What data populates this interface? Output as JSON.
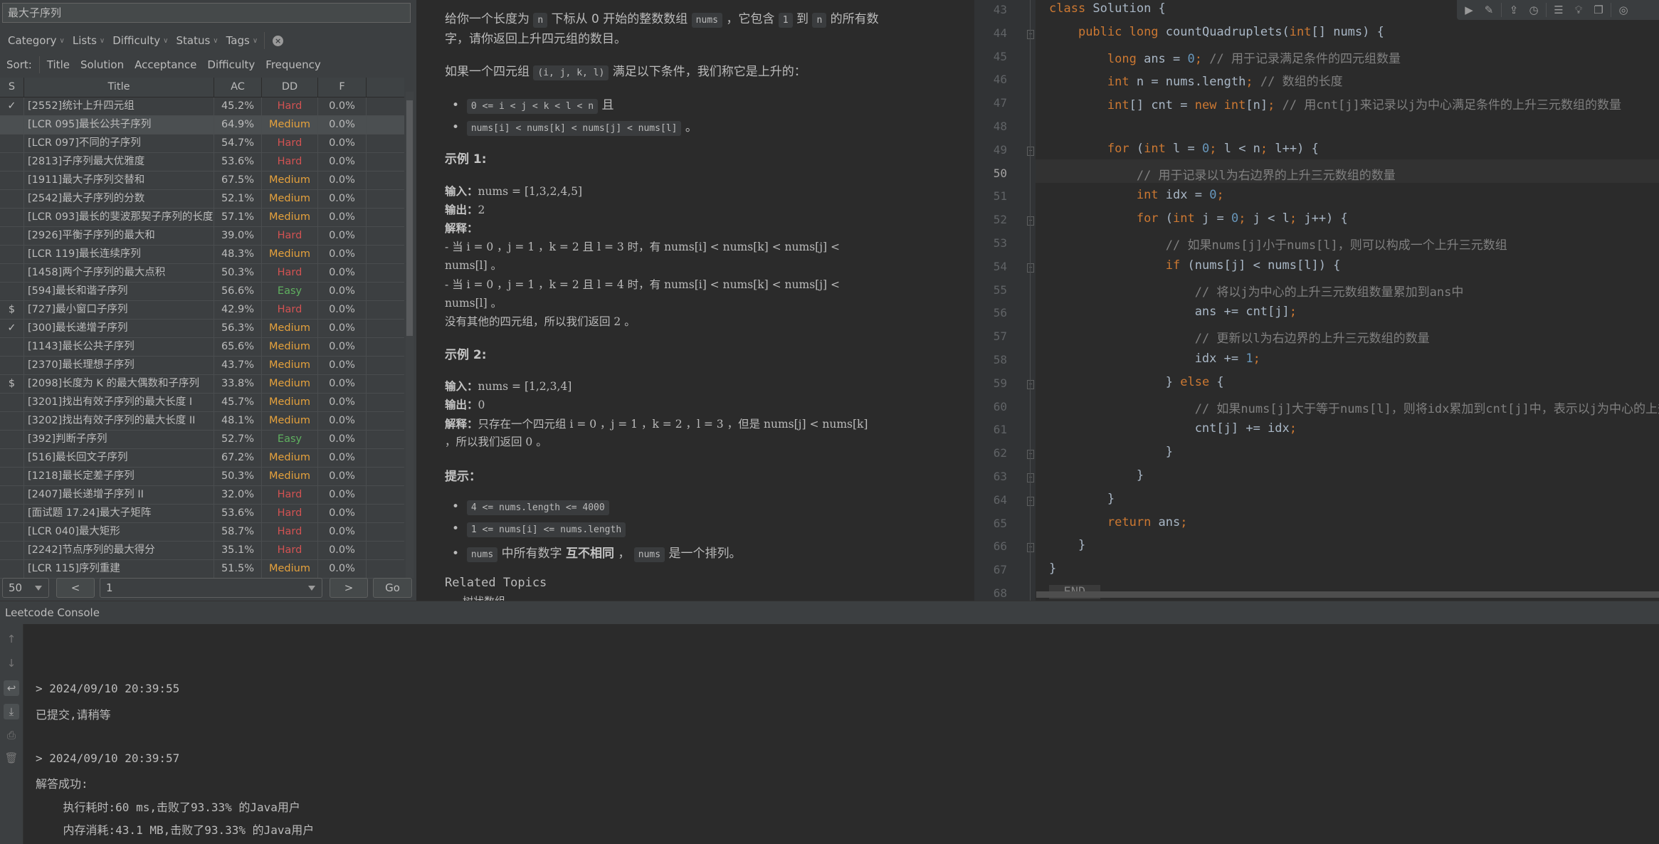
{
  "problem_list": {
    "search_value": "最大子序列",
    "filters": [
      "Category",
      "Lists",
      "Difficulty",
      "Status",
      "Tags"
    ],
    "sort_label": "Sort:",
    "sort_options": [
      "Title",
      "Solution",
      "Acceptance",
      "Difficulty",
      "Frequency"
    ],
    "columns": [
      "S",
      "Title",
      "AC",
      "DD",
      "F"
    ],
    "rows": [
      {
        "status": "✓",
        "title": "[2552]统计上升四元组",
        "ac": "45.2%",
        "difficulty": "Hard",
        "freq": "0.0%"
      },
      {
        "status": "",
        "title": "[LCR 095]最长公共子序列",
        "ac": "64.9%",
        "difficulty": "Medium",
        "freq": "0.0%"
      },
      {
        "status": "",
        "title": "[LCR 097]不同的子序列",
        "ac": "54.7%",
        "difficulty": "Hard",
        "freq": "0.0%"
      },
      {
        "status": "",
        "title": "[2813]子序列最大优雅度",
        "ac": "53.6%",
        "difficulty": "Hard",
        "freq": "0.0%"
      },
      {
        "status": "",
        "title": "[1911]最大子序列交替和",
        "ac": "67.5%",
        "difficulty": "Medium",
        "freq": "0.0%"
      },
      {
        "status": "",
        "title": "[2542]最大子序列的分数",
        "ac": "52.1%",
        "difficulty": "Medium",
        "freq": "0.0%"
      },
      {
        "status": "",
        "title": "[LCR 093]最长的斐波那契子序列的长度",
        "ac": "57.1%",
        "difficulty": "Medium",
        "freq": "0.0%"
      },
      {
        "status": "",
        "title": "[2926]平衡子序列的最大和",
        "ac": "39.0%",
        "difficulty": "Hard",
        "freq": "0.0%"
      },
      {
        "status": "",
        "title": "[LCR 119]最长连续序列",
        "ac": "48.3%",
        "difficulty": "Medium",
        "freq": "0.0%"
      },
      {
        "status": "",
        "title": "[1458]两个子序列的最大点积",
        "ac": "50.3%",
        "difficulty": "Hard",
        "freq": "0.0%"
      },
      {
        "status": "",
        "title": "[594]最长和谐子序列",
        "ac": "56.6%",
        "difficulty": "Easy",
        "freq": "0.0%"
      },
      {
        "status": "$",
        "title": "[727]最小窗口子序列",
        "ac": "42.9%",
        "difficulty": "Hard",
        "freq": "0.0%"
      },
      {
        "status": "✓",
        "title": "[300]最长递增子序列",
        "ac": "56.3%",
        "difficulty": "Medium",
        "freq": "0.0%"
      },
      {
        "status": "",
        "title": "[1143]最长公共子序列",
        "ac": "65.6%",
        "difficulty": "Medium",
        "freq": "0.0%"
      },
      {
        "status": "",
        "title": "[2370]最长理想子序列",
        "ac": "43.7%",
        "difficulty": "Medium",
        "freq": "0.0%"
      },
      {
        "status": "$",
        "title": "[2098]长度为 K 的最大偶数和子序列",
        "ac": "33.8%",
        "difficulty": "Medium",
        "freq": "0.0%"
      },
      {
        "status": "",
        "title": "[3201]找出有效子序列的最大长度 I",
        "ac": "45.7%",
        "difficulty": "Medium",
        "freq": "0.0%"
      },
      {
        "status": "",
        "title": "[3202]找出有效子序列的最大长度 II",
        "ac": "48.1%",
        "difficulty": "Medium",
        "freq": "0.0%"
      },
      {
        "status": "",
        "title": "[392]判断子序列",
        "ac": "52.7%",
        "difficulty": "Easy",
        "freq": "0.0%"
      },
      {
        "status": "",
        "title": "[516]最长回文子序列",
        "ac": "67.2%",
        "difficulty": "Medium",
        "freq": "0.0%"
      },
      {
        "status": "",
        "title": "[1218]最长定差子序列",
        "ac": "50.3%",
        "difficulty": "Medium",
        "freq": "0.0%"
      },
      {
        "status": "",
        "title": "[2407]最长递增子序列 II",
        "ac": "32.0%",
        "difficulty": "Hard",
        "freq": "0.0%"
      },
      {
        "status": "",
        "title": "[面试题 17.24]最大子矩阵",
        "ac": "53.6%",
        "difficulty": "Hard",
        "freq": "0.0%"
      },
      {
        "status": "",
        "title": "[LCR 040]最大矩形",
        "ac": "58.7%",
        "difficulty": "Hard",
        "freq": "0.0%"
      },
      {
        "status": "",
        "title": "[2242]节点序列的最大得分",
        "ac": "35.1%",
        "difficulty": "Hard",
        "freq": "0.0%"
      },
      {
        "status": "",
        "title": "[LCR 115]序列重建",
        "ac": "51.5%",
        "difficulty": "Medium",
        "freq": "0.0%"
      }
    ],
    "difficulty_colors": {
      "Hard": "#d25252",
      "Medium": "#e6a23c",
      "Easy": "#5fb05f"
    },
    "pager": {
      "page_size": "50",
      "prev": "<",
      "page": "1",
      "next": ">",
      "go": "Go"
    }
  },
  "description": {
    "intro_1": "给你一个长度为",
    "intro_n": "n",
    "intro_2": "下标从 0 开始的整数数组",
    "intro_nums": "nums",
    "intro_3": "，它包含",
    "intro_one": "1",
    "intro_4": "到",
    "intro_n2": "n",
    "intro_5": "的所有数",
    "intro_line2": "字，请你返回上升四元组的数目。",
    "cond_1": "如果一个四元组",
    "cond_tuple": "(i, j, k, l)",
    "cond_2": "满足以下条件，我们称它是上升的：",
    "bullet_1_code": "0 <= i < j < k < l < n",
    "bullet_1_after": "且",
    "bullet_2_code": "nums[i] < nums[k] < nums[j] < nums[l]",
    "bullet_2_after": "。",
    "ex1_title": "示例 1:",
    "ex1_input_label": "输入：",
    "ex1_input": "nums = [1,3,2,4,5]",
    "ex1_output_label": "输出：",
    "ex1_output": "2",
    "ex1_explain_label": "解释：",
    "ex1_l1": "- 当 i = 0 ，j = 1 ，k = 2 且 l = 3 时，有 nums[i] < nums[k] < nums[j] <",
    "ex1_l2": "nums[l] 。",
    "ex1_l3": "- 当 i = 0 ，j = 1 ，k = 2 且 l = 4 时，有 nums[i] < nums[k] < nums[j] <",
    "ex1_l4": "nums[l] 。",
    "ex1_l5": "没有其他的四元组，所以我们返回 2 。",
    "ex2_title": "示例 2:",
    "ex2_input_label": "输入：",
    "ex2_input": "nums = [1,2,3,4]",
    "ex2_output_label": "输出：",
    "ex2_output": "0",
    "ex2_explain_label": "解释：",
    "ex2_l1": "只存在一个四元组 i = 0 ，j = 1 ，k = 2 ，l = 3 ，但是 nums[j] < nums[k]",
    "ex2_l2": "，所以我们返回 0 。",
    "hint_title": "提示：",
    "hint_1": "4 <= nums.length <= 4000",
    "hint_2": "1 <= nums[i] <= nums.length",
    "hint_3_code": "nums",
    "hint_3_mid": "中所有数字",
    "hint_3_bold": "互不相同",
    "hint_3_comma": "，",
    "hint_3_code2": "nums",
    "hint_3_end": "是一个排列。",
    "related_title": "Related Topics",
    "related_first": "树状数组"
  },
  "editor": {
    "current_line": "50",
    "lines": [
      {
        "n": "43",
        "html": "<span class='kw'>class</span> Solution {"
      },
      {
        "n": "44",
        "html": "    <span class='kw'>public long</span> countQuadruplets(<span class='kw'>int</span>[] nums) {"
      },
      {
        "n": "45",
        "html": "        <span class='kw'>long</span> ans = <span class='num'>0</span><span class='semi'>;</span> <span class='cm'>// 用于记录满足条件的四元组数量</span>"
      },
      {
        "n": "46",
        "html": "        <span class='kw'>int</span> n = nums.length<span class='semi'>;</span> <span class='cm'>// 数组的长度</span>"
      },
      {
        "n": "47",
        "html": "        <span class='kw'>int</span>[] cnt = <span class='kw'>new int</span>[n]<span class='semi'>;</span> <span class='cm'>// 用cnt[j]来记录以j为中心满足条件的上升三元数组的数量</span>"
      },
      {
        "n": "48",
        "html": ""
      },
      {
        "n": "49",
        "html": "        <span class='kw'>for</span> (<span class='kw'>int</span> l = <span class='num'>0</span><span class='semi'>;</span> l &lt; n<span class='semi'>;</span> l++) {"
      },
      {
        "n": "50",
        "html": "            <span class='cm'>// 用于记录以l为右边界的上升三元数组的数量</span>"
      },
      {
        "n": "51",
        "html": "            <span class='kw'>int</span> idx = <span class='num'>0</span><span class='semi'>;</span>"
      },
      {
        "n": "52",
        "html": "            <span class='kw'>for</span> (<span class='kw'>int</span> j = <span class='num'>0</span><span class='semi'>;</span> j &lt; l<span class='semi'>;</span> j++) {"
      },
      {
        "n": "53",
        "html": "                <span class='cm'>// 如果nums[j]小于nums[l]，则可以构成一个上升三元数组</span>"
      },
      {
        "n": "54",
        "html": "                <span class='kw'>if</span> (nums[j] &lt; nums[l]) {"
      },
      {
        "n": "55",
        "html": "                    <span class='cm'>// 将以j为中心的上升三元数组数量累加到ans中</span>"
      },
      {
        "n": "56",
        "html": "                    ans += cnt[j]<span class='semi'>;</span>"
      },
      {
        "n": "57",
        "html": "                    <span class='cm'>// 更新以l为右边界的上升三元数组的数量</span>"
      },
      {
        "n": "58",
        "html": "                    idx += <span class='num'>1</span><span class='semi'>;</span>"
      },
      {
        "n": "59",
        "html": "                } <span class='kw'>else</span> {"
      },
      {
        "n": "60",
        "html": "                    <span class='cm'>// 如果nums[j]大于等于nums[l]，则将idx累加到cnt[j]中，表示以j为中心的上升三元数组数量</span>"
      },
      {
        "n": "61",
        "html": "                    cnt[j] += idx<span class='semi'>;</span>"
      },
      {
        "n": "62",
        "html": "                }"
      },
      {
        "n": "63",
        "html": "            }"
      },
      {
        "n": "64",
        "html": "        }"
      },
      {
        "n": "65",
        "html": "        <span class='kw'>return</span> ans<span class='semi'>;</span>"
      },
      {
        "n": "66",
        "html": "    }"
      },
      {
        "n": "67",
        "html": "}"
      },
      {
        "n": "68",
        "html": "<span id='end-marker'>--END--</span>"
      }
    ],
    "fold_lines": [
      "44",
      "49",
      "52",
      "54",
      "59",
      "62",
      "63",
      "64",
      "66"
    ],
    "toolbar_icons": [
      "run-icon",
      "test-edit-icon",
      "submit-icon",
      "submissions-history-icon",
      "comment-icon",
      "hint-icon",
      "window-icon",
      "locate-icon"
    ]
  },
  "console": {
    "title": "Leetcode Console",
    "lines": [
      "> 2024/09/10 20:39:55",
      "已提交,请稍等",
      "",
      "> 2024/09/10 20:39:57",
      "解答成功:",
      "    执行耗时:60 ms,击败了93.33% 的Java用户",
      "    内存消耗:43.1 MB,击败了93.33% 的Java用户"
    ]
  }
}
